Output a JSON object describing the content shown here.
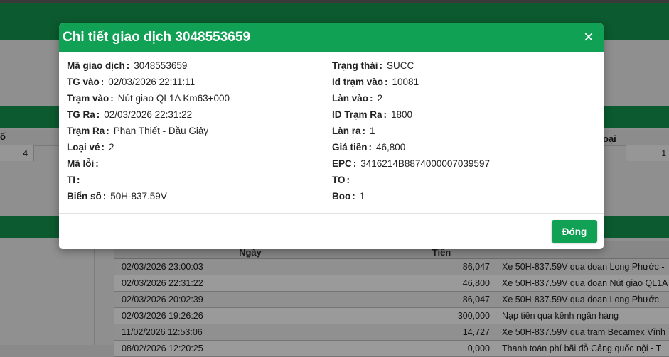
{
  "modal": {
    "title": "Chi tiết giao dịch 3048553659",
    "close_icon": "×",
    "left_fields": [
      {
        "label": "Mã giao dịch",
        "value": "3048553659"
      },
      {
        "label": "TG vào",
        "value": "02/03/2026 22:11:11"
      },
      {
        "label": "Trạm vào",
        "value": "Nút giao QL1A Km63+000"
      },
      {
        "label": "TG Ra",
        "value": "02/03/2026 22:31:22"
      },
      {
        "label": "Trạm Ra",
        "value": "Phan Thiết - Dầu Giây"
      },
      {
        "label": "Loại vé",
        "value": "2"
      },
      {
        "label": "Mã lỗi",
        "value": ""
      },
      {
        "label": "TI",
        "value": ""
      },
      {
        "label": "Biển số",
        "value": "50H-837.59V"
      }
    ],
    "right_fields": [
      {
        "label": "Trạng thái",
        "value": "SUCC"
      },
      {
        "label": "Id trạm vào",
        "value": "10081"
      },
      {
        "label": "Làn vào",
        "value": "2"
      },
      {
        "label": "ID Trạm Ra",
        "value": "1800"
      },
      {
        "label": "Làn ra",
        "value": "1"
      },
      {
        "label": "Giá tiền",
        "value": "46,800"
      },
      {
        "label": "EPC",
        "value": "3416214B8874000007039597"
      },
      {
        "label": "TO",
        "value": ""
      },
      {
        "label": "Boo",
        "value": "1"
      }
    ],
    "footer_button": "Đóng"
  },
  "background": {
    "grid_header_left": "ố",
    "grid_header_right": "oại",
    "grid_cell_left": "4",
    "grid_cell_right": "1",
    "table": {
      "headers": [
        "Ngày",
        "Tiền"
      ],
      "rows": [
        {
          "date": "02/03/2026 23:00:03",
          "amount": "86,047",
          "desc": "Xe 50H-837.59V qua doan Long Phước -"
        },
        {
          "date": "02/03/2026 22:31:22",
          "amount": "46,800",
          "desc": "Xe 50H-837.59V qua đoạn Nút giao QL1A"
        },
        {
          "date": "02/03/2026 20:02:39",
          "amount": "86,047",
          "desc": "Xe 50H-837.59V qua doan Long Phước -"
        },
        {
          "date": "02/03/2026 19:26:26",
          "amount": "300,000",
          "desc": "Nạp tiền qua kênh ngân hàng"
        },
        {
          "date": "11/02/2026 12:53:06",
          "amount": "14,727",
          "desc": "Xe 50H-837.59V qua tram Becamex Vĩnh"
        },
        {
          "date": "08/02/2026 12:20:25",
          "amount": "0,000",
          "desc": "Thanh toán phí bãi đỗ Cảng quốc nội - T"
        }
      ]
    }
  }
}
